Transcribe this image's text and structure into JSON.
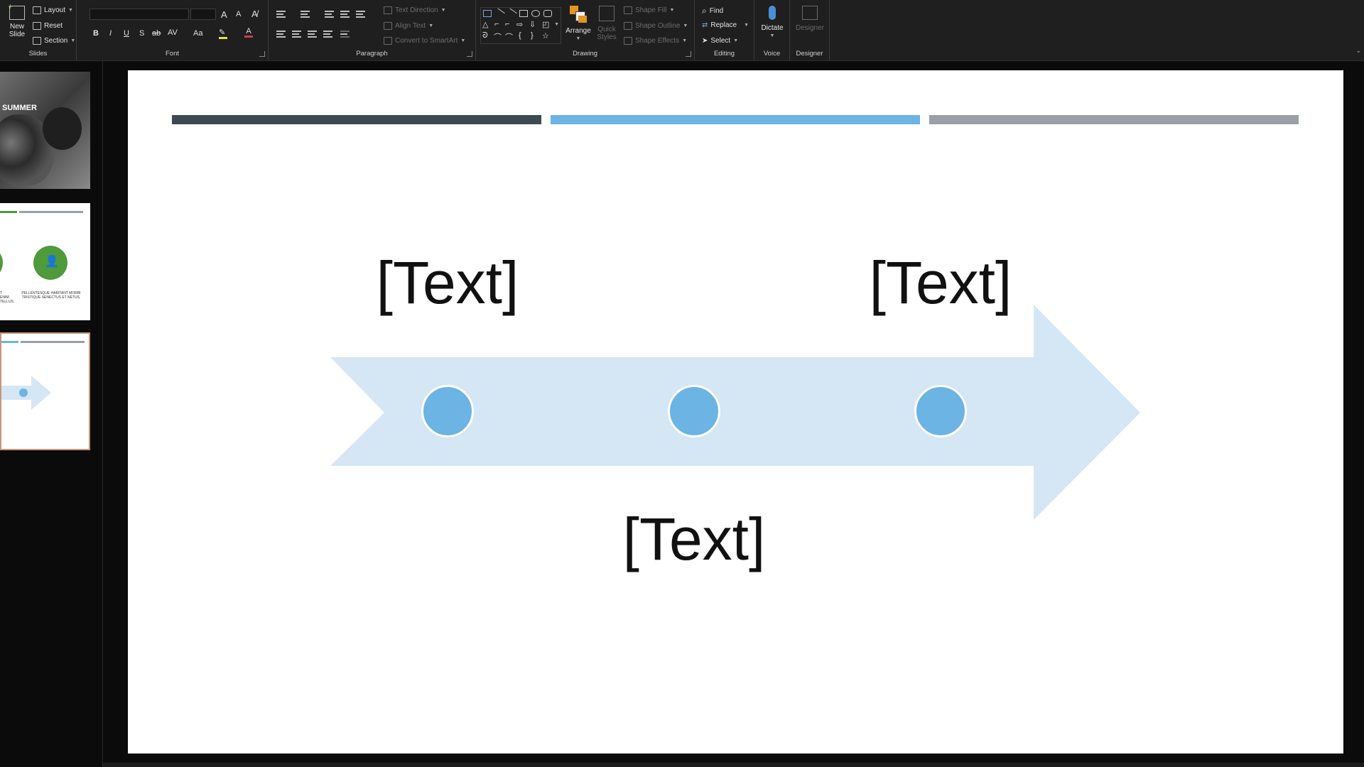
{
  "ribbon": {
    "slides": {
      "new_slide": "New",
      "new_slide2": "Slide",
      "layout": "Layout",
      "reset": "Reset",
      "section": "Section",
      "label": "Slides"
    },
    "font": {
      "label": "Font",
      "bold": "B",
      "italic": "I",
      "underline": "U",
      "shadow": "S",
      "strike": "ab",
      "spacing": "AV",
      "case": "Aa",
      "grow": "A",
      "shrink": "A"
    },
    "paragraph": {
      "label": "Paragraph",
      "text_direction": "Text Direction",
      "align_text": "Align Text",
      "convert_smartart": "Convert to SmartArt"
    },
    "drawing": {
      "label": "Drawing",
      "arrange": "Arrange",
      "quick_styles_1": "Quick",
      "quick_styles_2": "Styles",
      "shape_fill": "Shape Fill",
      "shape_outline": "Shape Outline",
      "shape_effects": "Shape Effects"
    },
    "editing": {
      "label": "Editing",
      "find": "Find",
      "replace": "Replace",
      "select": "Select"
    },
    "voice": {
      "label": "Voice",
      "dictate": "Dictate"
    },
    "designer": {
      "label": "Designer",
      "designer_btn": "Designer"
    }
  },
  "thumbnails": {
    "thumb1_title": "SUMMER",
    "thumb2_left_text": "T ENIM. TELLUS.",
    "thumb2_right_text_1": "PELLENTESQUE HABITANT MORBI",
    "thumb2_right_text_2": "TRISTIQUE SENECTUS ET NETUS."
  },
  "slide": {
    "top_left_text": "[Text]",
    "top_right_text": "[Text]",
    "bottom_text": "[Text]",
    "bar_colors": [
      "#3d4a52",
      "#6cb4e4",
      "#9aa0a6"
    ],
    "arrow_color": "#d5e6f5",
    "dot_color": "#6cb4e4"
  }
}
